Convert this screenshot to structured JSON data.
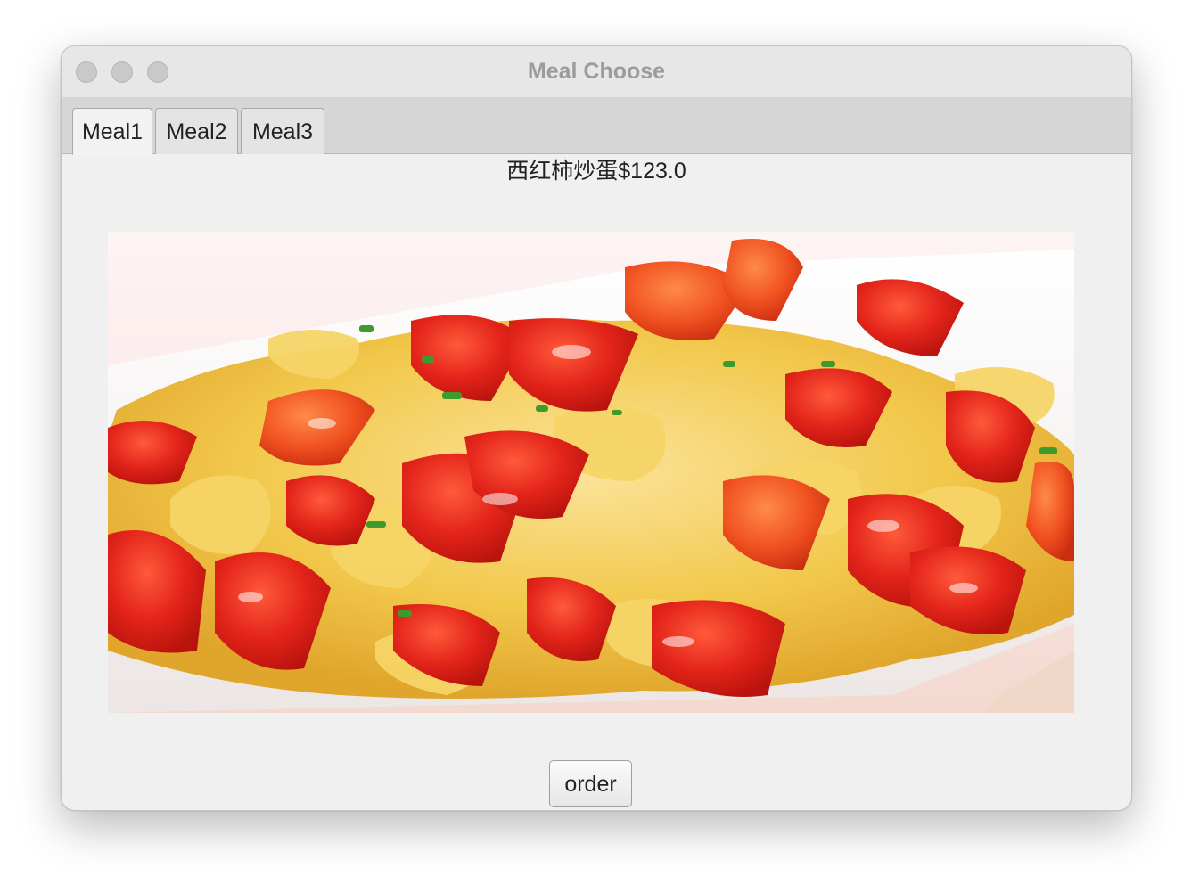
{
  "window": {
    "title": "Meal Choose"
  },
  "tabs": [
    {
      "label": "Meal1",
      "selected": true
    },
    {
      "label": "Meal2",
      "selected": false
    },
    {
      "label": "Meal3",
      "selected": false
    }
  ],
  "meal": {
    "label": "西红柿炒蛋$123.0",
    "image_icon": "tomato-egg-photo"
  },
  "actions": {
    "order_label": "order"
  },
  "colors": {
    "window_bg": "#f0f0f0",
    "titlebar_bg": "#e7e7e7",
    "tabbar_bg": "#d6d6d6",
    "title_text": "#9c9c9c",
    "tomato_red": "#e3241a",
    "egg_yellow": "#f2c84b"
  }
}
